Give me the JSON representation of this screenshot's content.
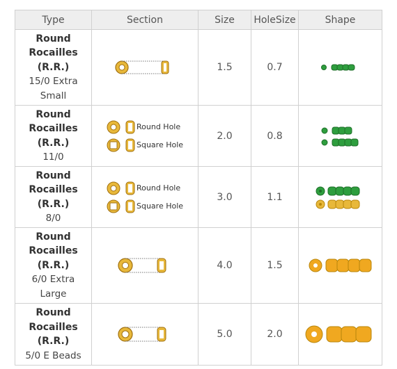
{
  "headers": [
    "Type",
    "Section",
    "Size",
    "HoleSize",
    "Shape"
  ],
  "rows": [
    {
      "name_lines": [
        "Round",
        "Rocailles",
        "(R.R.)"
      ],
      "size_line": "15/0 Extra Small",
      "section_labels": [],
      "size": "1.5",
      "hole_size": "0.7",
      "shape_color": "green"
    },
    {
      "name_lines": [
        "Round",
        "Rocailles",
        "(R.R.)"
      ],
      "size_line": "11/0",
      "section_labels": [
        "Round Hole",
        "Square Hole"
      ],
      "size": "2.0",
      "hole_size": "0.8",
      "shape_color": "green"
    },
    {
      "name_lines": [
        "Round",
        "Rocailles",
        "(R.R.)"
      ],
      "size_line": "8/0",
      "section_labels": [
        "Round Hole",
        "Square Hole"
      ],
      "size": "3.0",
      "hole_size": "1.1",
      "shape_color": "green-gold"
    },
    {
      "name_lines": [
        "Round",
        "Rocailles",
        "(R.R.)"
      ],
      "size_line": "6/0 Extra Large",
      "section_labels": [],
      "size": "4.0",
      "hole_size": "1.5",
      "shape_color": "gold"
    },
    {
      "name_lines": [
        "Round",
        "Rocailles",
        "(R.R.)"
      ],
      "size_line": "5/0 E Beads",
      "section_labels": [],
      "size": "5.0",
      "hole_size": "2.0",
      "shape_color": "gold"
    }
  ],
  "colors": {
    "bead_gold": "#e8b83a",
    "bead_gold_dark": "#b8860b",
    "bead_green": "#2e9e3e",
    "bead_green_dark": "#1d6e28"
  }
}
